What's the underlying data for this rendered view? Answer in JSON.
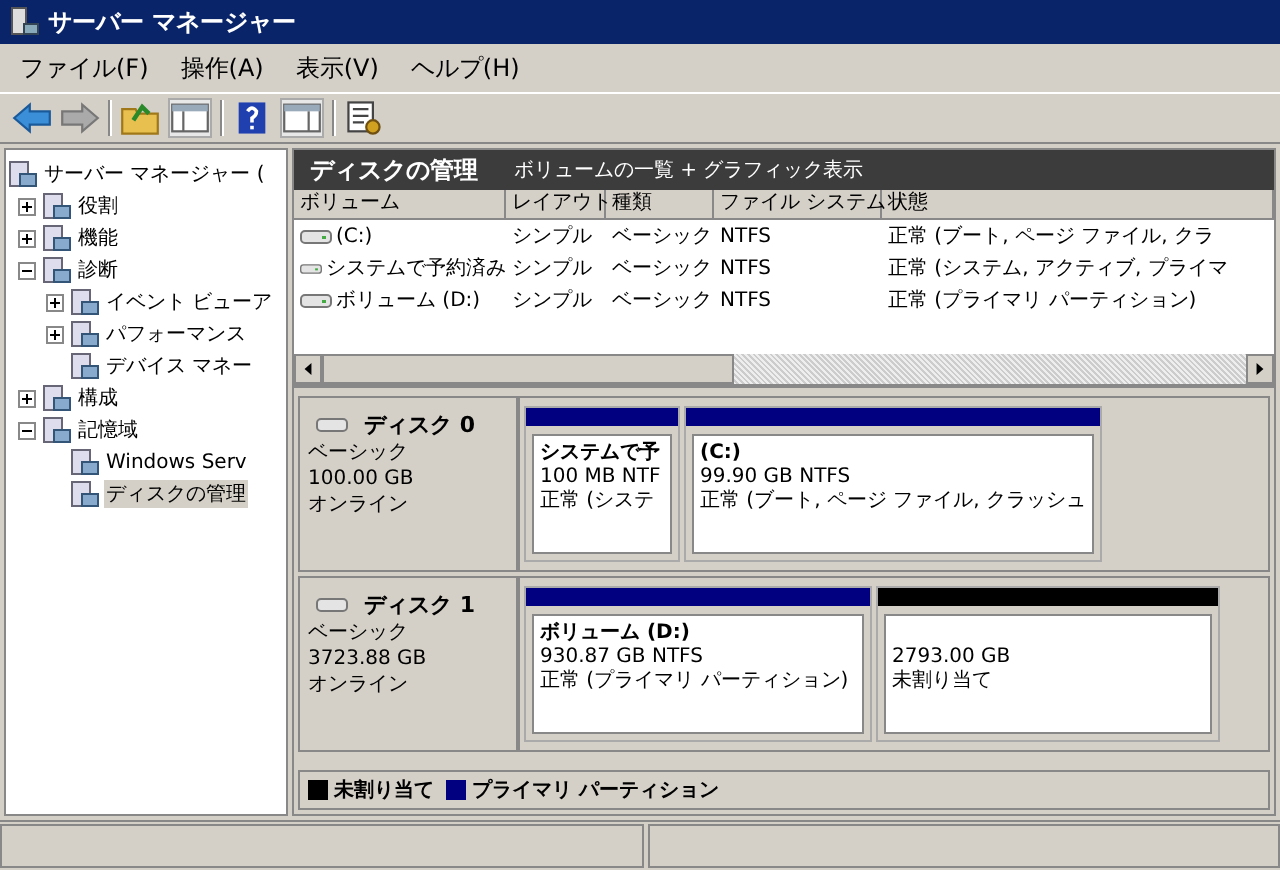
{
  "window": {
    "title": "サーバー マネージャー"
  },
  "menu": [
    "ファイル(F)",
    "操作(A)",
    "表示(V)",
    "ヘルプ(H)"
  ],
  "tree": {
    "label": "サーバー マネージャー (",
    "selected": false,
    "children": [
      {
        "label": "役割",
        "expanded": false,
        "selected": false
      },
      {
        "label": "機能",
        "expanded": false,
        "selected": false
      },
      {
        "label": "診断",
        "expanded": true,
        "selected": false,
        "children": [
          {
            "label": "イベント ビューア",
            "expanded": false,
            "selected": false
          },
          {
            "label": "パフォーマンス",
            "expanded": false,
            "selected": false
          },
          {
            "label": "デバイス マネー",
            "selected": false
          }
        ]
      },
      {
        "label": "構成",
        "expanded": false,
        "selected": false
      },
      {
        "label": "記憶域",
        "expanded": true,
        "selected": false,
        "children": [
          {
            "label": "Windows Serv",
            "selected": false
          },
          {
            "label": "ディスクの管理",
            "selected": true
          }
        ]
      }
    ]
  },
  "header": {
    "title": "ディスクの管理",
    "subtitle": "ボリュームの一覧 + グラフィック表示"
  },
  "table": {
    "columns": [
      "ボリューム",
      "レイアウト",
      "種類",
      "ファイル システム",
      "状態"
    ],
    "rows": [
      [
        "(C:)",
        "シンプル",
        "ベーシック",
        "NTFS",
        "正常 (ブート, ページ ファイル, クラ"
      ],
      [
        "システムで予約済み",
        "シンプル",
        "ベーシック",
        "NTFS",
        "正常 (システム, アクティブ, プライマ"
      ],
      [
        "ボリューム (D:)",
        "シンプル",
        "ベーシック",
        "NTFS",
        "正常 (プライマリ パーティション)"
      ]
    ]
  },
  "disks": [
    {
      "name": "ディスク 0",
      "type": "ベーシック",
      "size": "100.00 GB",
      "status": "オンライン",
      "partitions": [
        {
          "name": "システムで予",
          "size": "100 MB NTF",
          "status": "正常 (システ",
          "color": "#000080"
        },
        {
          "name": "(C:)",
          "size": "99.90 GB NTFS",
          "status": "正常 (ブート, ページ ファイル, クラッシュ",
          "color": "#000080"
        }
      ]
    },
    {
      "name": "ディスク 1",
      "type": "ベーシック",
      "size": "3723.88 GB",
      "status": "オンライン",
      "partitions": [
        {
          "name": "ボリューム (D:)",
          "size": "930.87 GB NTFS",
          "status": "正常 (プライマリ パーティション)",
          "color": "#000080"
        },
        {
          "size": "2793.00 GB",
          "status": "未割り当て",
          "color": "#000000"
        }
      ]
    }
  ],
  "legend": [
    {
      "label": "未割り当て",
      "color": "#000000"
    },
    {
      "label": "プライマリ パーティション",
      "color": "#000080"
    }
  ]
}
